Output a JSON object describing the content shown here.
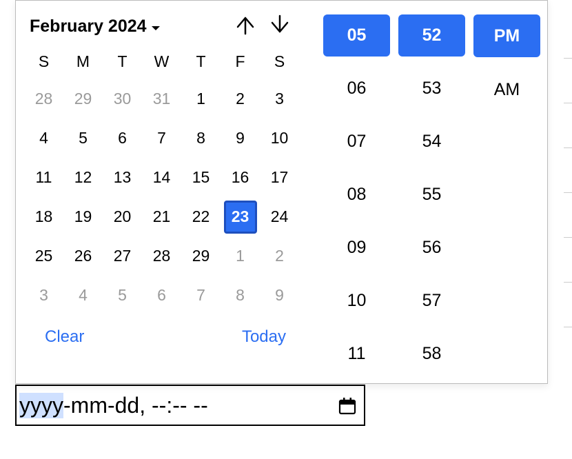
{
  "header": {
    "month_label": "February 2024"
  },
  "weekdays": [
    "S",
    "M",
    "T",
    "W",
    "T",
    "F",
    "S"
  ],
  "days": [
    {
      "n": "28",
      "muted": true
    },
    {
      "n": "29",
      "muted": true
    },
    {
      "n": "30",
      "muted": true
    },
    {
      "n": "31",
      "muted": true
    },
    {
      "n": "1"
    },
    {
      "n": "2"
    },
    {
      "n": "3"
    },
    {
      "n": "4"
    },
    {
      "n": "5"
    },
    {
      "n": "6"
    },
    {
      "n": "7"
    },
    {
      "n": "8"
    },
    {
      "n": "9"
    },
    {
      "n": "10"
    },
    {
      "n": "11"
    },
    {
      "n": "12"
    },
    {
      "n": "13"
    },
    {
      "n": "14"
    },
    {
      "n": "15"
    },
    {
      "n": "16"
    },
    {
      "n": "17"
    },
    {
      "n": "18"
    },
    {
      "n": "19"
    },
    {
      "n": "20"
    },
    {
      "n": "21"
    },
    {
      "n": "22"
    },
    {
      "n": "23",
      "selected": true
    },
    {
      "n": "24"
    },
    {
      "n": "25"
    },
    {
      "n": "26"
    },
    {
      "n": "27"
    },
    {
      "n": "28"
    },
    {
      "n": "29"
    },
    {
      "n": "1",
      "muted": true
    },
    {
      "n": "2",
      "muted": true
    },
    {
      "n": "3",
      "muted": true
    },
    {
      "n": "4",
      "muted": true
    },
    {
      "n": "5",
      "muted": true
    },
    {
      "n": "6",
      "muted": true
    },
    {
      "n": "7",
      "muted": true
    },
    {
      "n": "8",
      "muted": true
    },
    {
      "n": "9",
      "muted": true
    }
  ],
  "footer": {
    "clear": "Clear",
    "today": "Today"
  },
  "time": {
    "hours": [
      {
        "v": "05",
        "sel": true
      },
      {
        "v": "06"
      },
      {
        "v": "07"
      },
      {
        "v": "08"
      },
      {
        "v": "09"
      },
      {
        "v": "10"
      },
      {
        "v": "11"
      }
    ],
    "minutes": [
      {
        "v": "52",
        "sel": true
      },
      {
        "v": "53"
      },
      {
        "v": "54"
      },
      {
        "v": "55"
      },
      {
        "v": "56"
      },
      {
        "v": "57"
      },
      {
        "v": "58"
      }
    ],
    "period": [
      {
        "v": "PM",
        "sel": true
      },
      {
        "v": "AM"
      }
    ]
  },
  "input": {
    "seg1": "yyyy",
    "seg2": "-mm-dd, --:-- --"
  }
}
